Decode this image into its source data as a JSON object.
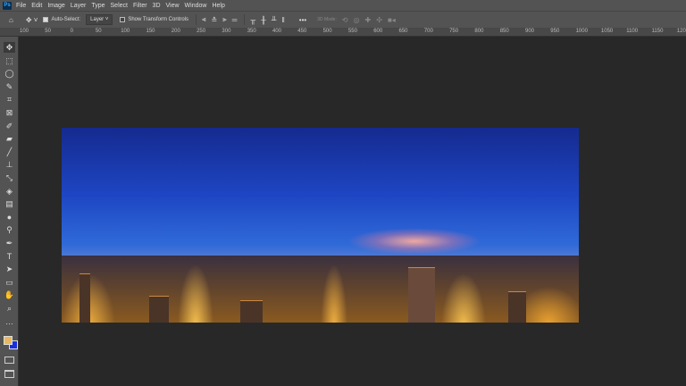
{
  "app": {
    "logo": "Ps"
  },
  "menu": [
    "File",
    "Edit",
    "Image",
    "Layer",
    "Type",
    "Select",
    "Filter",
    "3D",
    "View",
    "Window",
    "Help"
  ],
  "options": {
    "auto_select_label": "Auto-Select:",
    "auto_select_checked": true,
    "layer_select": "Layer",
    "show_transform_label": "Show Transform Controls",
    "show_transform_checked": false,
    "mode_3d_label": "3D Mode:",
    "more": "•••"
  },
  "ruler": [
    "100",
    "50",
    "0",
    "50",
    "100",
    "150",
    "200",
    "250",
    "300",
    "350",
    "400",
    "450",
    "500",
    "550",
    "600",
    "650",
    "700",
    "750",
    "800",
    "850",
    "900",
    "950",
    "1000",
    "1050",
    "1100",
    "1150",
    "1200"
  ],
  "tools": [
    "move",
    "marquee",
    "lasso",
    "quick-select",
    "crop",
    "frame",
    "eyedropper",
    "healing",
    "brush",
    "stamp",
    "history-brush",
    "eraser",
    "gradient",
    "blur",
    "dodge",
    "pen",
    "type",
    "path-select",
    "rectangle",
    "hand",
    "zoom",
    "more"
  ],
  "colors": {
    "foreground": "#e8b860",
    "background": "#1a2ee0"
  }
}
